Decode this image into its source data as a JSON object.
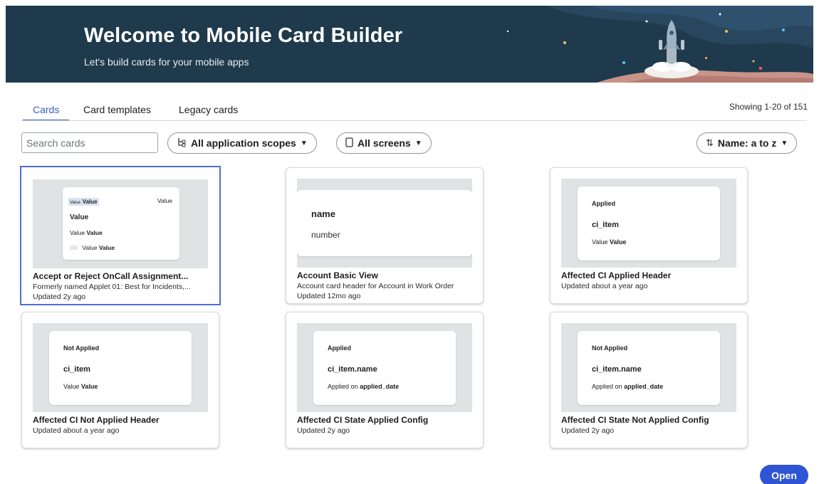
{
  "banner": {
    "title": "Welcome to Mobile Card Builder",
    "subtitle": "Let's build cards for your mobile apps"
  },
  "tabs": [
    {
      "label": "Cards",
      "active": true
    },
    {
      "label": "Card templates",
      "active": false
    },
    {
      "label": "Legacy cards",
      "active": false
    }
  ],
  "showing": "Showing 1-20 of 151",
  "search": {
    "placeholder": "Search cards",
    "value": ""
  },
  "filters": {
    "scopes": {
      "icon": "tree-icon",
      "label": "All application scopes"
    },
    "screens": {
      "icon": "phone-icon",
      "label": "All screens"
    },
    "sort": {
      "icon": "sort-arrows-icon",
      "label": "Name: a to z"
    }
  },
  "cards": [
    {
      "title": "Accept or Reject OnCall Assignment...",
      "subtitle": "Formerly named Applet 01: Best for Incidents,...",
      "updated": "Updated 2y ago",
      "preview": {
        "tag_small": "Value",
        "tag_bold": "Value",
        "right": "Value",
        "heading": "Value",
        "row1_label": "Value",
        "row1_value": "Value",
        "row2_label": "Value",
        "row2_value": "Value"
      }
    },
    {
      "title": "Account Basic View",
      "subtitle": "Account card header for Account in Work Order",
      "updated": "Updated 12mo ago",
      "preview": {
        "heading": "name",
        "line": "number"
      }
    },
    {
      "title": "Affected CI Applied Header",
      "updated": "Updated about a year ago",
      "preview": {
        "status": "Applied",
        "heading": "ci_item",
        "label": "Value",
        "value": "Value"
      }
    },
    {
      "title": "Affected CI Not Applied Header",
      "updated": "Updated about a year ago",
      "preview": {
        "status": "Not Applied",
        "heading": "ci_item",
        "label": "Value",
        "value": "Value"
      }
    },
    {
      "title": "Affected CI State Applied Config",
      "updated": "Updated 2y ago",
      "preview": {
        "status": "Applied",
        "heading": "ci_item.name",
        "label": "Applied on",
        "value": "applied_date"
      }
    },
    {
      "title": "Affected CI State Not Applied Config",
      "updated": "Updated 2y ago",
      "preview": {
        "status": "Not Applied",
        "heading": "ci_item.name",
        "label": "Applied on",
        "value": "applied_date"
      }
    }
  ],
  "open_button": "Open",
  "colors": {
    "banner": "#1f3a4c",
    "accent": "#3a5fc8",
    "open_button": "#2f55d4"
  }
}
